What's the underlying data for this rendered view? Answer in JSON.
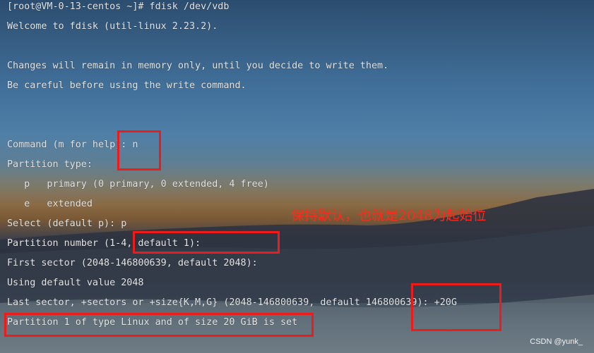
{
  "terminal": {
    "lines": [
      "[root@VM-0-13-centos ~]# fdisk /dev/vdb",
      "Welcome to fdisk (util-linux 2.23.2).",
      "",
      "Changes will remain in memory only, until you decide to write them.",
      "Be careful before using the write command.",
      "",
      "",
      "Command (m for help): n",
      "Partition type:",
      "   p   primary (0 primary, 0 extended, 4 free)",
      "   e   extended",
      "Select (default p): p",
      "Partition number (1-4, default 1):",
      "First sector (2048-146800639, default 2048):",
      "Using default value 2048",
      "Last sector, +sectors or +size{K,M,G} (2048-146800639, default 146800639): +20G",
      "Partition 1 of type Linux and of size 20 GiB is set"
    ]
  },
  "annotation": {
    "text": "保持默认，也就是2048为起始位"
  },
  "watermark": {
    "text": "CSDN @yunk_"
  },
  "colors": {
    "highlight": "#ee1b1b",
    "annotation": "#ff2a1a",
    "terminal_text": "#e6e6e6"
  }
}
